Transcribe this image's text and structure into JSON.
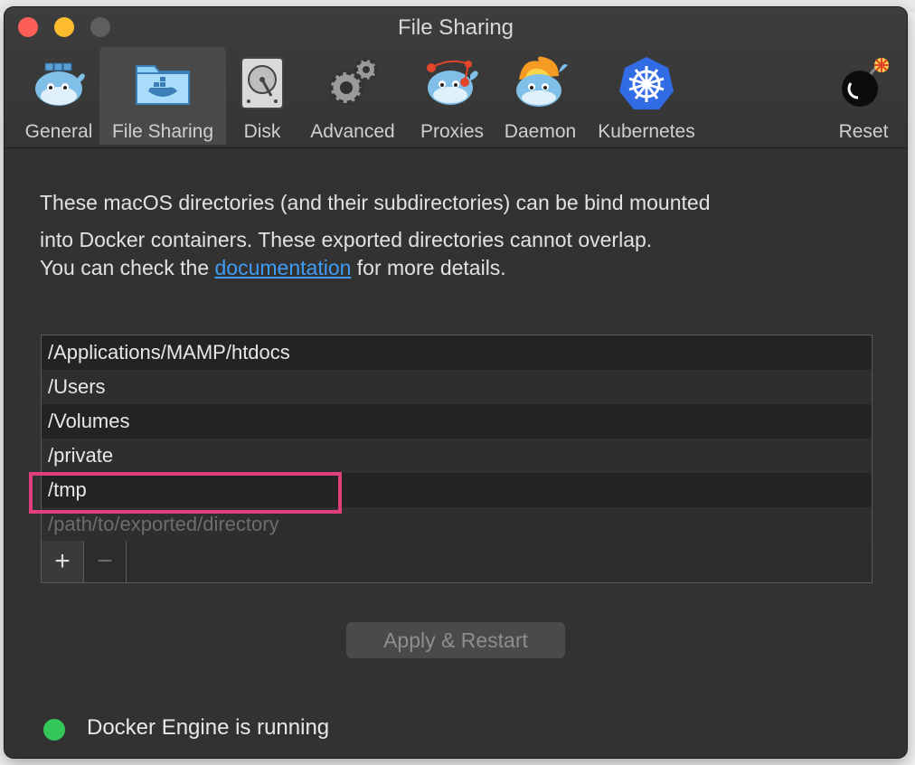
{
  "window": {
    "title": "File Sharing"
  },
  "toolbar": {
    "items": [
      {
        "label": "General",
        "icon": "whale-general-icon"
      },
      {
        "label": "File Sharing",
        "icon": "folder-whale-icon",
        "selected": true
      },
      {
        "label": "Disk",
        "icon": "disk-icon"
      },
      {
        "label": "Advanced",
        "icon": "gears-icon"
      },
      {
        "label": "Proxies",
        "icon": "whale-proxies-icon"
      },
      {
        "label": "Daemon",
        "icon": "whale-daemon-icon"
      },
      {
        "label": "Kubernetes",
        "icon": "kubernetes-icon"
      },
      {
        "label": "Reset",
        "icon": "bomb-icon"
      }
    ]
  },
  "description": {
    "line1": "These macOS directories (and their subdirectories) can be bind mounted",
    "line2": "into Docker containers. These exported directories cannot overlap.",
    "line3_before": "You can check the ",
    "link_text": "documentation",
    "line3_after": " for more details."
  },
  "directories": {
    "items": [
      "/Applications/MAMP/htdocs",
      "/Users",
      "/Volumes",
      "/private",
      "/tmp"
    ],
    "placeholder": "/path/to/exported/directory",
    "add_label": "+",
    "remove_label": "−"
  },
  "apply_button": {
    "label": "Apply & Restart"
  },
  "status": {
    "text": "Docker Engine is running",
    "color": "#33c75a"
  },
  "colors": {
    "link": "#3f9cf6",
    "highlight": "#e03f7b",
    "window_bg": "#323232"
  }
}
